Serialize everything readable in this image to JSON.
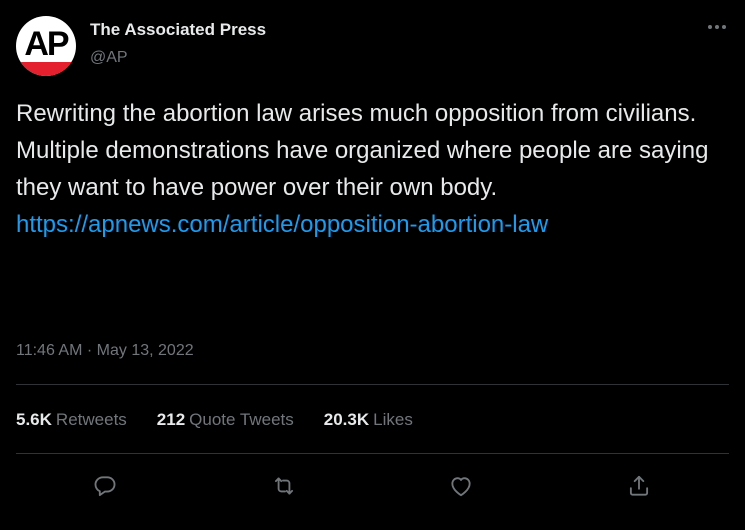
{
  "header": {
    "logo_text": "AP",
    "display_name": "The Associated Press",
    "handle": "@AP"
  },
  "tweet": {
    "text": "Rewriting the abortion law arises much opposition from civilians. Multiple demonstrations have organized where people are saying they want to have power over their own body.",
    "link": "https://apnews.com/article/opposition-abortion-law"
  },
  "meta": {
    "time": "11:46 AM",
    "separator": "·",
    "date": "May 13, 2022"
  },
  "stats": {
    "retweets": {
      "count": "5.6K",
      "label": "Retweets"
    },
    "quotes": {
      "count": "212",
      "label": "Quote Tweets"
    },
    "likes": {
      "count": "20.3K",
      "label": "Likes"
    }
  },
  "actions": [
    "reply-icon",
    "retweet-icon",
    "like-icon",
    "share-icon"
  ],
  "colors": {
    "background": "#000000",
    "text": "#e7e9ea",
    "secondary": "#71767b",
    "link": "#1d9bf0",
    "divider": "#2f3336",
    "ap_red": "#e4202e"
  }
}
